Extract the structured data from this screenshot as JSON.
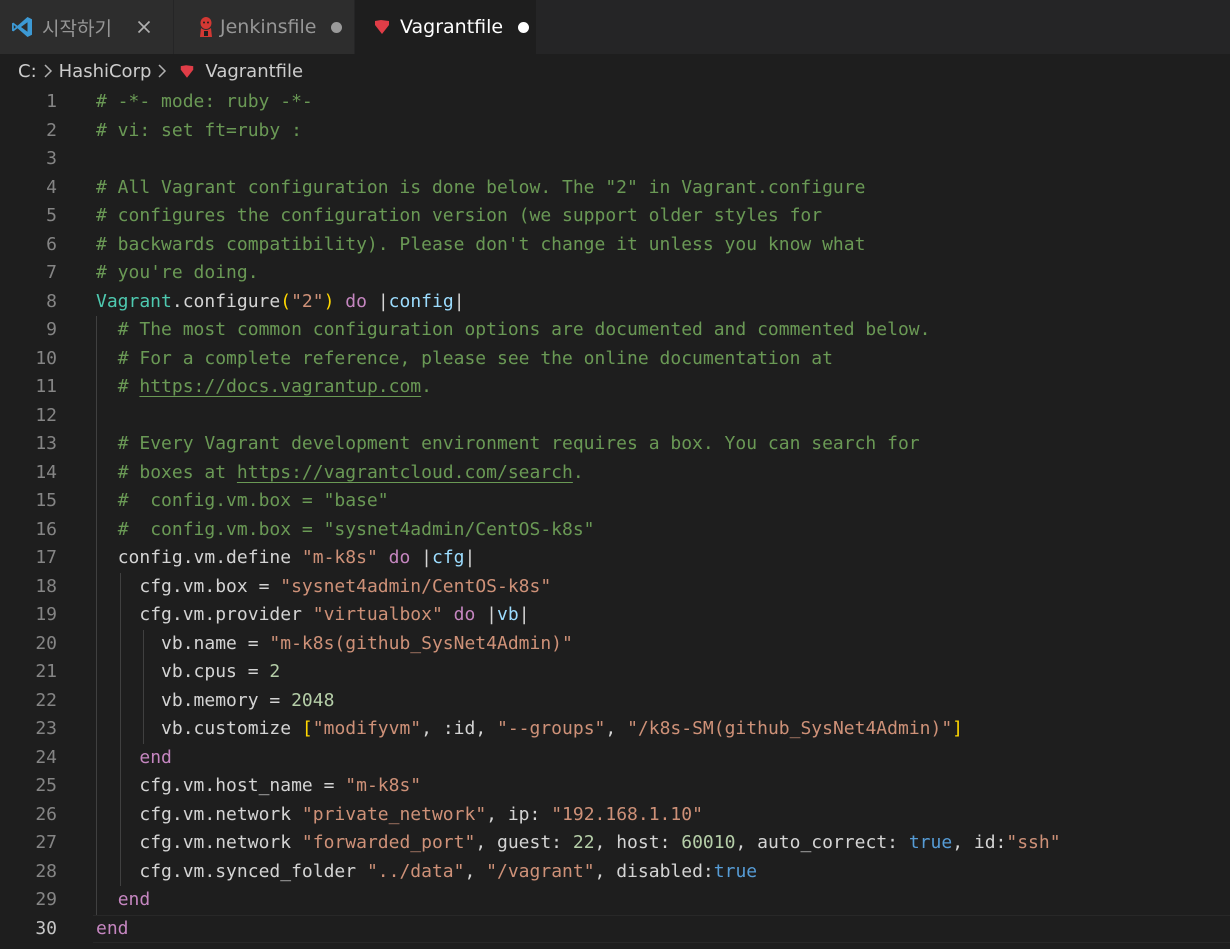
{
  "colors": {
    "tabbar_bg": "#252526",
    "editor_bg": "#1e1e1e",
    "vscode_blue": "#3c99d4",
    "vagrant_red": "#e03d47",
    "jenkins_red": "#d33833"
  },
  "tabs": [
    {
      "icon": "vscode-icon",
      "label": "시작하기",
      "action": "close-icon",
      "active": false
    },
    {
      "icon": "jenkins-icon",
      "label": "Jenkinsfile",
      "action": "unsaved-dot",
      "active": false
    },
    {
      "icon": "vagrant-icon",
      "label": "Vagrantfile",
      "action": "unsaved-dot",
      "active": true
    }
  ],
  "breadcrumb": {
    "drive": "C:",
    "folder": "HashiCorp",
    "file": "Vagrantfile",
    "file_icon": "vagrant-icon",
    "separator_icon": "chevron-right-icon"
  },
  "editor": {
    "current_line": 30,
    "language": "ruby",
    "lines": [
      {
        "n": "1",
        "indent": 0,
        "tokens": [
          {
            "t": "comment",
            "v": "# -*- mode: ruby -*-"
          }
        ]
      },
      {
        "n": "2",
        "indent": 0,
        "tokens": [
          {
            "t": "comment",
            "v": "# vi: set ft=ruby :"
          }
        ]
      },
      {
        "n": "3",
        "indent": 0,
        "tokens": []
      },
      {
        "n": "4",
        "indent": 0,
        "tokens": [
          {
            "t": "comment",
            "v": "# All Vagrant configuration is done below. The \"2\" in Vagrant.configure"
          }
        ]
      },
      {
        "n": "5",
        "indent": 0,
        "tokens": [
          {
            "t": "comment",
            "v": "# configures the configuration version (we support older styles for"
          }
        ]
      },
      {
        "n": "6",
        "indent": 0,
        "tokens": [
          {
            "t": "comment",
            "v": "# backwards compatibility). Please don't change it unless you know what"
          }
        ]
      },
      {
        "n": "7",
        "indent": 0,
        "tokens": [
          {
            "t": "comment",
            "v": "# you're doing."
          }
        ]
      },
      {
        "n": "8",
        "indent": 0,
        "tokens": [
          {
            "t": "const",
            "v": "Vagrant"
          },
          {
            "t": "default",
            "v": "."
          },
          {
            "t": "default",
            "v": "configure"
          },
          {
            "t": "bracket-gold",
            "v": "("
          },
          {
            "t": "string",
            "v": "\"2\""
          },
          {
            "t": "bracket-gold",
            "v": ")"
          },
          {
            "t": "default",
            "v": " "
          },
          {
            "t": "keyword",
            "v": "do"
          },
          {
            "t": "default",
            "v": " "
          },
          {
            "t": "pipe",
            "v": "|"
          },
          {
            "t": "param",
            "v": "config"
          },
          {
            "t": "pipe",
            "v": "|"
          }
        ]
      },
      {
        "n": "9",
        "indent": 1,
        "tokens": [
          {
            "t": "comment",
            "v": "# The most common configuration options are documented and commented below."
          }
        ]
      },
      {
        "n": "10",
        "indent": 1,
        "tokens": [
          {
            "t": "comment",
            "v": "# For a complete reference, please see the online documentation at"
          }
        ]
      },
      {
        "n": "11",
        "indent": 1,
        "tokens": [
          {
            "t": "comment",
            "v": "# "
          },
          {
            "t": "link",
            "v": "https://docs.vagrantup.com"
          },
          {
            "t": "comment",
            "v": "."
          }
        ]
      },
      {
        "n": "12",
        "indent": 1,
        "tokens": []
      },
      {
        "n": "13",
        "indent": 1,
        "tokens": [
          {
            "t": "comment",
            "v": "# Every Vagrant development environment requires a box. You can search for"
          }
        ]
      },
      {
        "n": "14",
        "indent": 1,
        "tokens": [
          {
            "t": "comment",
            "v": "# boxes at "
          },
          {
            "t": "link",
            "v": "https://vagrantcloud.com/search"
          },
          {
            "t": "comment",
            "v": "."
          }
        ]
      },
      {
        "n": "15",
        "indent": 1,
        "tokens": [
          {
            "t": "comment",
            "v": "#  config.vm.box = \"base\""
          }
        ]
      },
      {
        "n": "16",
        "indent": 1,
        "tokens": [
          {
            "t": "comment",
            "v": "#  config.vm.box = \"sysnet4admin/CentOS-k8s\""
          }
        ]
      },
      {
        "n": "17",
        "indent": 1,
        "tokens": [
          {
            "t": "default",
            "v": "config.vm.define "
          },
          {
            "t": "string",
            "v": "\"m-k8s\""
          },
          {
            "t": "default",
            "v": " "
          },
          {
            "t": "keyword",
            "v": "do"
          },
          {
            "t": "default",
            "v": " "
          },
          {
            "t": "pipe",
            "v": "|"
          },
          {
            "t": "param",
            "v": "cfg"
          },
          {
            "t": "pipe",
            "v": "|"
          }
        ]
      },
      {
        "n": "18",
        "indent": 2,
        "tokens": [
          {
            "t": "default",
            "v": "cfg.vm.box = "
          },
          {
            "t": "string",
            "v": "\"sysnet4admin/CentOS-k8s\""
          }
        ]
      },
      {
        "n": "19",
        "indent": 2,
        "tokens": [
          {
            "t": "default",
            "v": "cfg.vm.provider "
          },
          {
            "t": "string",
            "v": "\"virtualbox\""
          },
          {
            "t": "default",
            "v": " "
          },
          {
            "t": "keyword",
            "v": "do"
          },
          {
            "t": "default",
            "v": " "
          },
          {
            "t": "pipe",
            "v": "|"
          },
          {
            "t": "param",
            "v": "vb"
          },
          {
            "t": "pipe",
            "v": "|"
          }
        ]
      },
      {
        "n": "20",
        "indent": 3,
        "tokens": [
          {
            "t": "default",
            "v": "vb.name = "
          },
          {
            "t": "string",
            "v": "\"m-k8s(github_SysNet4Admin)\""
          }
        ]
      },
      {
        "n": "21",
        "indent": 3,
        "tokens": [
          {
            "t": "default",
            "v": "vb.cpus = "
          },
          {
            "t": "number",
            "v": "2"
          }
        ]
      },
      {
        "n": "22",
        "indent": 3,
        "tokens": [
          {
            "t": "default",
            "v": "vb.memory = "
          },
          {
            "t": "number",
            "v": "2048"
          }
        ]
      },
      {
        "n": "23",
        "indent": 3,
        "tokens": [
          {
            "t": "default",
            "v": "vb.customize "
          },
          {
            "t": "bracket-gold",
            "v": "["
          },
          {
            "t": "string",
            "v": "\"modifyvm\""
          },
          {
            "t": "default",
            "v": ", :id, "
          },
          {
            "t": "string",
            "v": "\"--groups\""
          },
          {
            "t": "default",
            "v": ", "
          },
          {
            "t": "string",
            "v": "\"/k8s-SM(github_SysNet4Admin)\""
          },
          {
            "t": "bracket-gold",
            "v": "]"
          }
        ]
      },
      {
        "n": "24",
        "indent": 2,
        "tokens": [
          {
            "t": "keyword",
            "v": "end"
          }
        ]
      },
      {
        "n": "25",
        "indent": 2,
        "tokens": [
          {
            "t": "default",
            "v": "cfg.vm.host_name = "
          },
          {
            "t": "string",
            "v": "\"m-k8s\""
          }
        ]
      },
      {
        "n": "26",
        "indent": 2,
        "tokens": [
          {
            "t": "default",
            "v": "cfg.vm.network "
          },
          {
            "t": "string",
            "v": "\"private_network\""
          },
          {
            "t": "default",
            "v": ", ip: "
          },
          {
            "t": "string",
            "v": "\"192.168.1.10\""
          }
        ]
      },
      {
        "n": "27",
        "indent": 2,
        "tokens": [
          {
            "t": "default",
            "v": "cfg.vm.network "
          },
          {
            "t": "string",
            "v": "\"forwarded_port\""
          },
          {
            "t": "default",
            "v": ", guest: "
          },
          {
            "t": "number",
            "v": "22"
          },
          {
            "t": "default",
            "v": ", host: "
          },
          {
            "t": "number",
            "v": "60010"
          },
          {
            "t": "default",
            "v": ", auto_correct: "
          },
          {
            "t": "bool",
            "v": "true"
          },
          {
            "t": "default",
            "v": ", id:"
          },
          {
            "t": "string",
            "v": "\"ssh\""
          }
        ]
      },
      {
        "n": "28",
        "indent": 2,
        "tokens": [
          {
            "t": "default",
            "v": "cfg.vm.synced_folder "
          },
          {
            "t": "string",
            "v": "\"../data\""
          },
          {
            "t": "default",
            "v": ", "
          },
          {
            "t": "string",
            "v": "\"/vagrant\""
          },
          {
            "t": "default",
            "v": ", disabled:"
          },
          {
            "t": "bool",
            "v": "true"
          }
        ]
      },
      {
        "n": "29",
        "indent": 1,
        "tokens": [
          {
            "t": "keyword",
            "v": "end"
          }
        ]
      },
      {
        "n": "30",
        "indent": 0,
        "tokens": [
          {
            "t": "keyword",
            "v": "end"
          }
        ]
      }
    ]
  }
}
